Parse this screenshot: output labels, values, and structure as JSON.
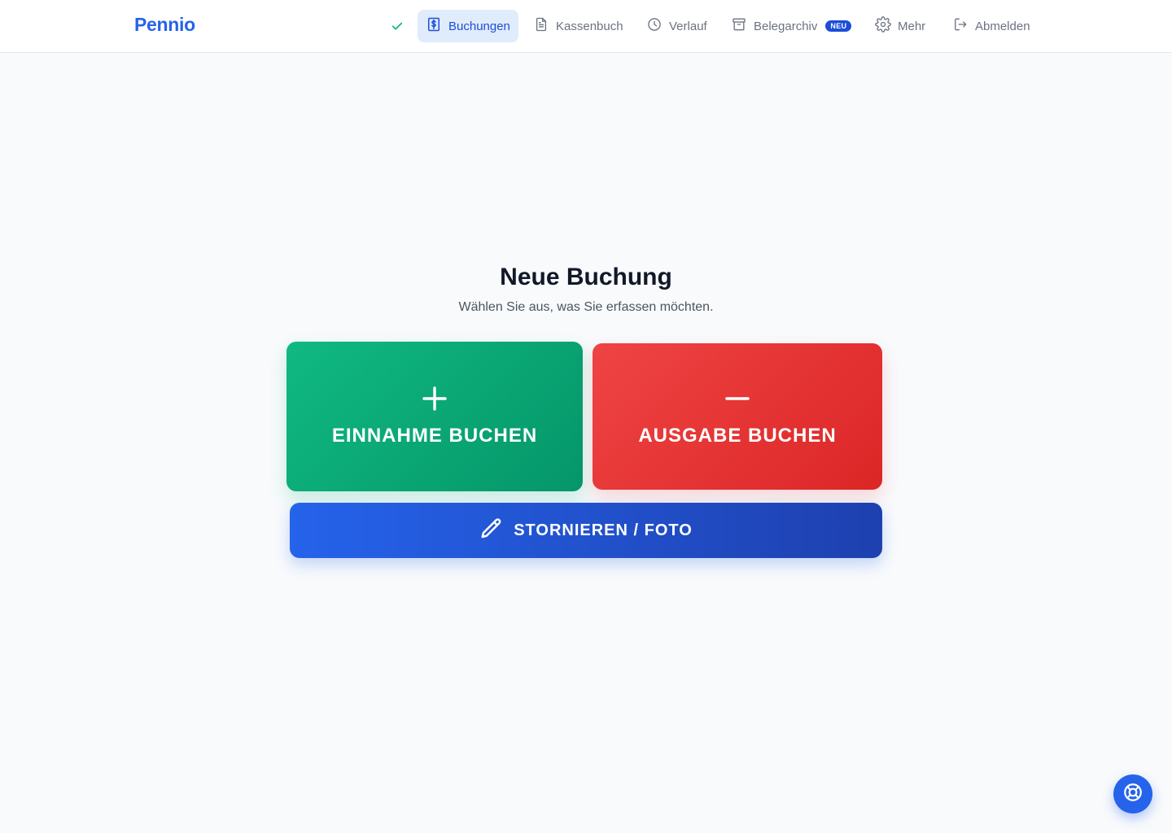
{
  "brand": {
    "name": "Pennio",
    "color": "#2563eb"
  },
  "nav": {
    "status_icon": "check-icon",
    "items": [
      {
        "label": "Buchungen",
        "icon": "receipt-dollar-icon",
        "active": true
      },
      {
        "label": "Kassenbuch",
        "icon": "document-icon",
        "active": false
      },
      {
        "label": "Verlauf",
        "icon": "clock-icon",
        "active": false
      },
      {
        "label": "Belegarchiv",
        "icon": "archive-box-icon",
        "active": false,
        "badge": "NEU"
      },
      {
        "label": "Mehr",
        "icon": "gear-icon",
        "active": false
      },
      {
        "label": "Abmelden",
        "icon": "logout-icon",
        "active": false
      }
    ]
  },
  "main": {
    "title": "Neue Buchung",
    "subtitle": "Wählen Sie aus, was Sie erfassen möchten.",
    "income": {
      "label": "EINNAHME BUCHEN",
      "icon": "plus-icon",
      "color": "#10b981"
    },
    "expense": {
      "label": "AUSGABE BUCHEN",
      "icon": "minus-icon",
      "color": "#ef4444"
    },
    "cancel": {
      "label": "STORNIEREN / FOTO",
      "icon": "pencil-icon",
      "color": "#2563eb"
    }
  },
  "help": {
    "icon": "lifebuoy-icon"
  }
}
